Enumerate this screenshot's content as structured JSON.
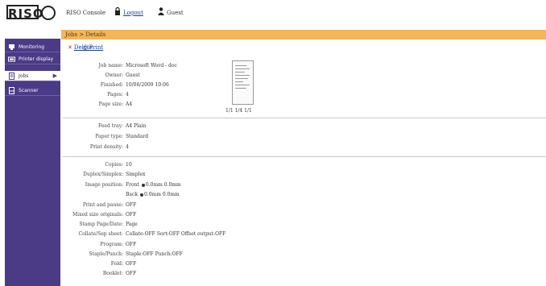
{
  "header": {
    "console_label": "RISO Console",
    "logout_label": "Logout",
    "user_label": "Guest"
  },
  "sidebar": {
    "items": [
      {
        "label": "Monitoring",
        "icon": "monitor-icon"
      },
      {
        "label": "Printer display",
        "icon": "display-icon"
      },
      {
        "label": "Jobs",
        "icon": "jobs-icon",
        "active": true
      },
      {
        "label": "Scanner",
        "icon": "scanner-icon"
      }
    ]
  },
  "page": {
    "title": "Jobs > Details",
    "delete_label": "Delete",
    "print_label": "Print"
  },
  "job_info": {
    "job_name_label": "Job name:",
    "job_name_value": "Microsoft Word - doc",
    "owner_label": "Owner:",
    "owner_value": "Guest",
    "finished_label": "Finished:",
    "finished_value": "10/06/2009 10:06",
    "pages_label": "Pages:",
    "pages_value": "4",
    "page_size_label": "Page size:",
    "page_size_value": "A4"
  },
  "preview": {
    "nav_text": "1/1   1/4   1/1"
  },
  "paper": {
    "feed_tray_label": "Feed tray:",
    "feed_tray_value": "A4 Plain",
    "paper_type_label": "Paper type:",
    "paper_type_value": "Standard",
    "print_density_label": "Print density:",
    "print_density_value": "4"
  },
  "settings": {
    "copies_label": "Copies:",
    "copies_value": "10",
    "duplex_label": "Duplex/Simplex:",
    "duplex_value": "Simplex",
    "image_pos_label": "Image position:",
    "front_label": "Front",
    "front_value": "0.0mm  0.0mm",
    "back_label": "Back",
    "back_value": "0.0mm  0.0mm",
    "print_pause_label": "Print and pause:",
    "print_pause_value": "OFF",
    "mixed_size_label": "Mixed size originals:",
    "mixed_size_value": "OFF",
    "stamp_label": "Stamp Page/Date:",
    "stamp_value": "Page",
    "collate_label": "Collate/Sep sheet:",
    "collate_value": "Collate:OFF   Sort:OFF   Offset output:OFF",
    "program_label": "Program:",
    "program_value": "OFF",
    "staple_label": "Staple/Punch:",
    "staple_value": "Staple:OFF  Punch:OFF",
    "fold_label": "Fold:",
    "fold_value": "OFF",
    "booklet_label": "Booklet:",
    "booklet_value": "OFF"
  }
}
